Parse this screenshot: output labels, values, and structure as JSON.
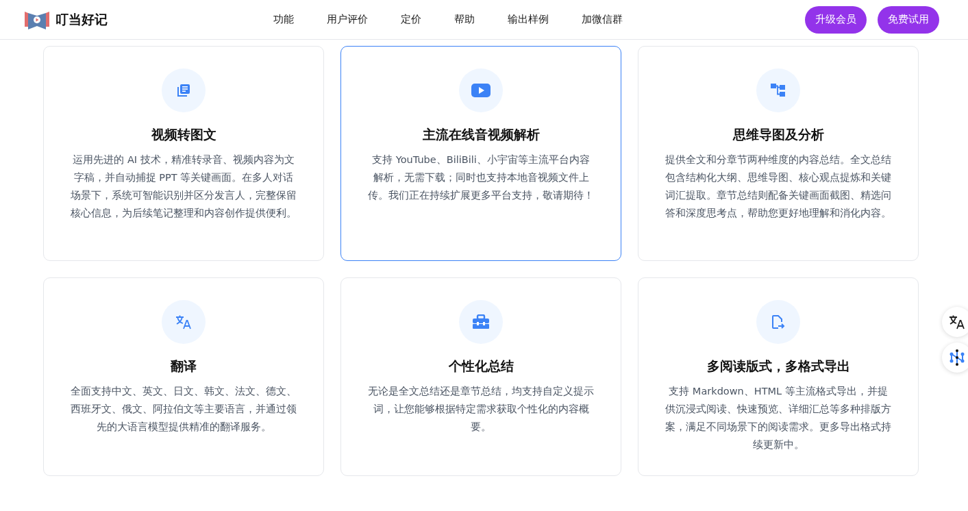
{
  "header": {
    "brand": "叮当好记",
    "nav": [
      "功能",
      "用户评价",
      "定价",
      "帮助",
      "输出样例",
      "加微信群"
    ],
    "buttons": [
      "升级会员",
      "免费试用"
    ]
  },
  "features": [
    {
      "kind": "document",
      "title": "视频转图文",
      "text": "运用先进的 AI 技术，精准转录音、视频内容为文字稿，并自动捕捉 PPT 等关键画面。在多人对话场景下，系统可智能识别并区分发言人，完整保留核心信息，为后续笔记整理和内容创作提供便利。",
      "highlighted": false
    },
    {
      "kind": "play",
      "title": "主流在线音视频解析",
      "text": "支持 YouTube、BiliBili、小宇宙等主流平台内容解析，无需下载；同时也支持本地音视频文件上传。我们正在持续扩展更多平台支持，敬请期待！",
      "highlighted": true
    },
    {
      "kind": "mindmap",
      "title": "思维导图及分析",
      "text": "提供全文和分章节两种维度的内容总结。全文总结包含结构化大纲、思维导图、核心观点提炼和关键词汇提取。章节总结则配备关键画面截图、精选问答和深度思考点，帮助您更好地理解和消化内容。",
      "highlighted": false
    },
    {
      "kind": "translate",
      "title": "翻译",
      "text": "全面支持中文、英文、日文、韩文、法文、德文、西班牙文、俄文、阿拉伯文等主要语言，并通过领先的大语言模型提供精准的翻译服务。",
      "highlighted": false
    },
    {
      "kind": "toolbox",
      "title": "个性化总结",
      "text": "无论是全文总结还是章节总结，均支持自定义提示词，让您能够根据特定需求获取个性化的内容概要。",
      "highlighted": false
    },
    {
      "kind": "export",
      "title": "多阅读版式，多格式导出",
      "text": "支持 Markdown、HTML 等主流格式导出，并提供沉浸式阅读、快速预览、详细汇总等多种排版方案，满足不同场景下的阅读需求。更多导出格式持续更新中。",
      "highlighted": false
    }
  ],
  "floating_buttons": [
    {
      "kind": "translate"
    },
    {
      "kind": "nodes"
    }
  ]
}
